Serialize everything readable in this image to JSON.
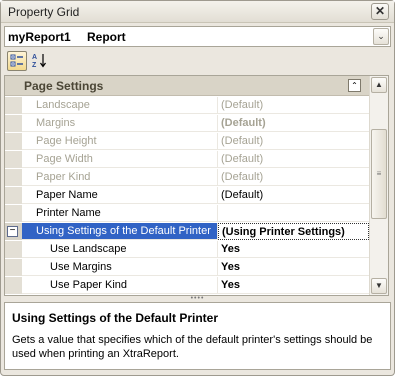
{
  "window": {
    "title": "Property Grid",
    "close_glyph": "✕"
  },
  "selector": {
    "object_name": "myReport1",
    "object_type": "Report",
    "dropdown_glyph": "⌄"
  },
  "toolbar": {
    "categorized_icon": "categorized-icon",
    "alphabetical_icon": "alphabetical-icon"
  },
  "category": {
    "label": "Page Settings",
    "collapse_glyph": "⌃"
  },
  "rows": [
    {
      "name": "Landscape",
      "value": "(Default)",
      "disabled": true
    },
    {
      "name": "Margins",
      "value": "(Default)",
      "disabled": true,
      "bold_value": true
    },
    {
      "name": "Page Height",
      "value": "(Default)",
      "disabled": true
    },
    {
      "name": "Page Width",
      "value": "(Default)",
      "disabled": true
    },
    {
      "name": "Paper Kind",
      "value": "(Default)",
      "disabled": true
    },
    {
      "name": "Paper Name",
      "value": "(Default)"
    },
    {
      "name": "Printer Name",
      "value": ""
    },
    {
      "name": "Using Settings of the Default Printer",
      "value": "(Using Printer Settings)",
      "selected": true,
      "expander": "−"
    },
    {
      "name": "Use Landscape",
      "value": "Yes",
      "sub": true
    },
    {
      "name": "Use Margins",
      "value": "Yes",
      "sub": true
    },
    {
      "name": "Use Paper Kind",
      "value": "Yes",
      "sub": true
    }
  ],
  "scrollbar": {
    "up_glyph": "▲",
    "down_glyph": "▼",
    "thumb_glyph": "≡"
  },
  "splitter": {
    "grip": "••••"
  },
  "description": {
    "title": "Using Settings of the Default Printer",
    "text": "Gets a value that specifies which of the default printer's settings should be used when printing an XtraReport."
  },
  "colors": {
    "selection": "#3163c5",
    "category_bg": "#d9d4c7",
    "window_bg": "#ebe7df"
  }
}
